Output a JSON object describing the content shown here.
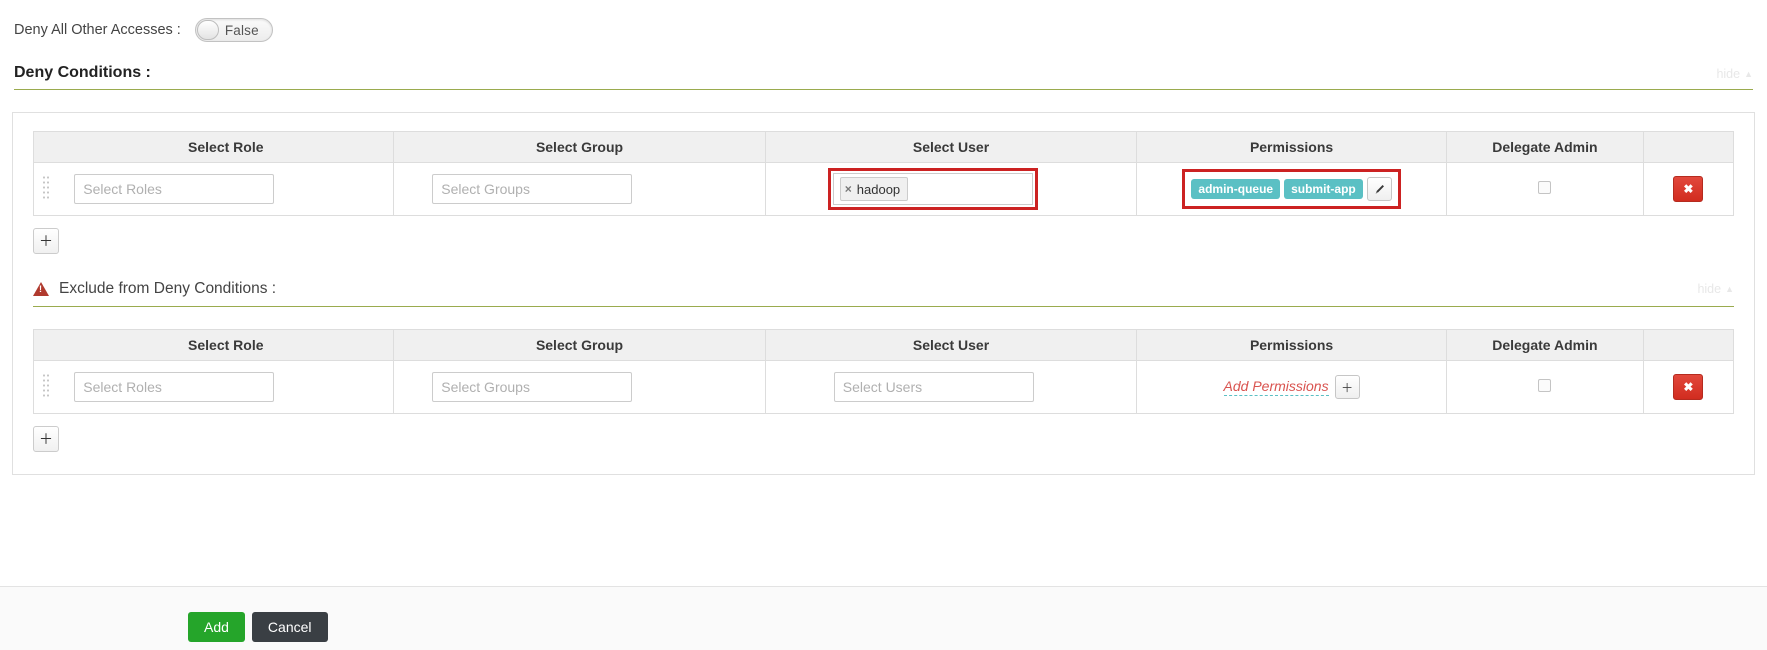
{
  "deny_all": {
    "label": "Deny All Other Accesses :",
    "toggle_value": "False"
  },
  "deny_conditions": {
    "title": "Deny Conditions :",
    "hide_label": "hide",
    "hide_caret": "▲",
    "table": {
      "headers": [
        "Select Role",
        "Select Group",
        "Select User",
        "Permissions",
        "Delegate Admin"
      ],
      "row": {
        "role_placeholder": "Select Roles",
        "role_value": "",
        "group_placeholder": "Select Groups",
        "group_value": "",
        "user_tags": [
          {
            "label": "hadoop",
            "remove": "×"
          }
        ],
        "permissions": [
          "admin-queue",
          "submit-app"
        ],
        "edit_icon": "pencil-icon",
        "delegate_admin_checked": false,
        "delete_label": "✖"
      },
      "add_row_label": "＋"
    }
  },
  "exclude_from_deny": {
    "title": "Exclude from Deny Conditions :",
    "warn_icon": "warning-triangle-icon",
    "hide_label": "hide",
    "hide_caret": "▲",
    "table": {
      "headers": [
        "Select Role",
        "Select Group",
        "Select User",
        "Permissions",
        "Delegate Admin"
      ],
      "row": {
        "role_placeholder": "Select Roles",
        "role_value": "",
        "group_placeholder": "Select Groups",
        "group_value": "",
        "user_placeholder": "Select Users",
        "user_value": "",
        "add_permissions_label": "Add Permissions",
        "add_permissions_button": "＋",
        "delegate_admin_checked": false,
        "delete_label": "✖"
      },
      "add_row_label": "＋"
    }
  },
  "footer": {
    "add_label": "Add",
    "cancel_label": "Cancel"
  },
  "colors": {
    "accent_green": "#25a52a",
    "danger_red": "#d12c1f",
    "badge_teal": "#5bc0c4",
    "rule_olive": "#9aab4e",
    "link_red": "#d9534f"
  }
}
